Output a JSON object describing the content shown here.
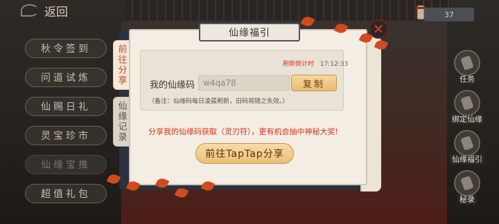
{
  "top_bar": {
    "back_label": "返回",
    "currency_value": "37"
  },
  "left_menu": {
    "items": [
      {
        "label": "秋令签到",
        "dim": false
      },
      {
        "label": "问道试炼",
        "dim": false
      },
      {
        "label": "仙赐日礼",
        "dim": false
      },
      {
        "label": "灵宝珍市",
        "dim": false
      },
      {
        "label": "仙缘宝推",
        "dim": true
      },
      {
        "label": "超值礼包",
        "dim": false
      }
    ]
  },
  "right_icons": {
    "items": [
      {
        "label": "任务",
        "icon": "scroll-icon"
      },
      {
        "label": "绑定仙缘",
        "icon": "bind-icon"
      },
      {
        "label": "仙缘福引",
        "icon": "fortune-icon"
      },
      {
        "label": "秘录",
        "icon": "book-icon"
      }
    ]
  },
  "dialog": {
    "title": "仙缘福引",
    "tabs": [
      {
        "label": "前往分享",
        "active": true
      },
      {
        "label": "仙缘记录",
        "active": false
      }
    ],
    "refresh_label": "刷新倒计时",
    "refresh_time": "17:12:33",
    "code_label": "我的仙缘码",
    "code_value": "w4qa78",
    "copy_label": "复制",
    "remark": "（备注：仙缘码每日凌晨刷新，旧码将随之失效。）",
    "share_text": "分享我的仙缘码获取（灵刃符），更有机会抽中神秘大奖!",
    "share_button": "前往TapTap分享",
    "close_symbol": "✕"
  },
  "colors": {
    "accent_red": "#d8341c",
    "button_gold": "#ebc07a",
    "panel_bg": "#f3ede3"
  }
}
